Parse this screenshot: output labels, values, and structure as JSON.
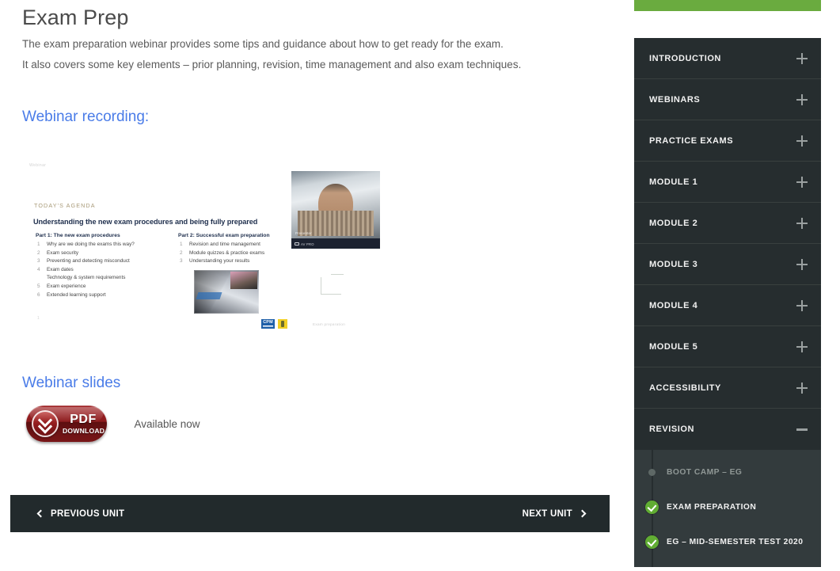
{
  "main": {
    "title": "Exam Prep",
    "intro_1": "The exam preparation webinar provides some tips and guidance about how to get ready for the exam.",
    "intro_2": "It also covers some key elements – prior planning, revision, time management and also exam techniques.",
    "recording_heading": "Webinar recording:",
    "slides_heading": "Webinar slides",
    "download": {
      "icon": "download-circle-icon",
      "line_1": "PDF",
      "line_2": "DOWNLOAD",
      "availability": "Available now"
    },
    "unit_nav": {
      "previous_label": "PREVIOUS UNIT",
      "next_label": "NEXT UNIT",
      "previous_icon": "chevron-left-icon",
      "next_icon": "chevron-right-icon"
    }
  },
  "slide": {
    "faint_top": "Webinar",
    "agenda_label": "TODAY'S AGENDA",
    "agenda_title": "Understanding the new exam procedures and being fully prepared",
    "part1": {
      "heading": "Part 1: The new exam procedures",
      "items": [
        "Why are we doing the exams this way?",
        "Exam security",
        "Preventing and detecting misconduct",
        "Exam dates",
        "Technology & system requirements",
        "Exam experience",
        "Extended learning support"
      ]
    },
    "part2": {
      "heading": "Part 2: Successful exam preparation",
      "items": [
        "Revision and time management",
        "Module quizzes & practice exams",
        "Understanding your results"
      ]
    },
    "webcam": {
      "presenter_name": "Presenter",
      "status_label": "AV PRO"
    },
    "footer_logo": "CPM",
    "footer_right": "Exam preparation"
  },
  "sidebar": {
    "accent_color": "#6aab3f",
    "panel_color": "#262d2f",
    "sublist_color": "#333b3d",
    "sections": [
      {
        "label": "INTRODUCTION",
        "state": "collapsed",
        "toggle_icon": "plus-icon"
      },
      {
        "label": "WEBINARS",
        "state": "collapsed",
        "toggle_icon": "plus-icon"
      },
      {
        "label": "PRACTICE EXAMS",
        "state": "collapsed",
        "toggle_icon": "plus-icon"
      },
      {
        "label": "MODULE 1",
        "state": "collapsed",
        "toggle_icon": "plus-icon"
      },
      {
        "label": "MODULE 2",
        "state": "collapsed",
        "toggle_icon": "plus-icon"
      },
      {
        "label": "MODULE 3",
        "state": "collapsed",
        "toggle_icon": "plus-icon"
      },
      {
        "label": "MODULE 4",
        "state": "collapsed",
        "toggle_icon": "plus-icon"
      },
      {
        "label": "MODULE 5",
        "state": "collapsed",
        "toggle_icon": "plus-icon"
      },
      {
        "label": "ACCESSIBILITY",
        "state": "collapsed",
        "toggle_icon": "plus-icon"
      },
      {
        "label": "REVISION",
        "state": "expanded",
        "toggle_icon": "minus-icon"
      }
    ],
    "revision_items": [
      {
        "label": "BOOT CAMP – EG",
        "status": "incomplete",
        "icon": "dot-icon"
      },
      {
        "label": "EXAM PREPARATION",
        "status": "complete",
        "icon": "check-circle-icon"
      },
      {
        "label": "EG – MID-SEMESTER TEST 2020",
        "status": "complete",
        "icon": "check-circle-icon"
      }
    ]
  }
}
